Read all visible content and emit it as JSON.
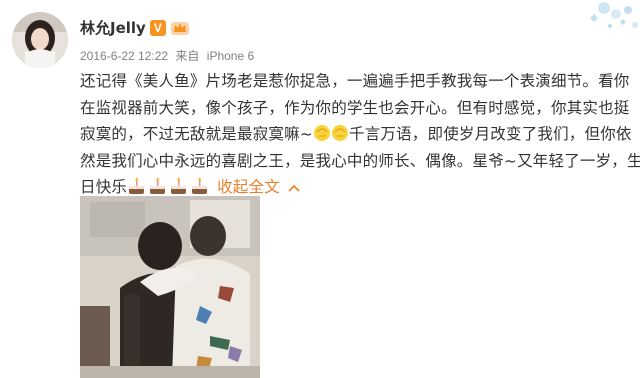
{
  "user": {
    "name": "林允Jelly",
    "verified_badge": "V",
    "verified_color": "#f7931e"
  },
  "post": {
    "timestamp": "2016-6-22 12:22",
    "source_prefix": "来自",
    "source": "iPhone 6",
    "lines": [
      "还记得《美人鱼》片场老是惹你捉急，一遍遍手把手教我每一个表演细节。看你",
      "在监视器前大笑，像个孩子，作为你的学生也会开心。但有时感觉，你其实也挺",
      "寂寞的，不过无敌就是最寂寞嘛~",
      "千言万语，即使岁月改变了我们，但你依",
      "然是我们心中永远的喜剧之王，是我心中的师长、偶像。星爷~又年轻了一岁，生",
      "日快乐"
    ],
    "collapse_label": "收起全文",
    "accent_color": "#ea7f26"
  },
  "icons": {
    "crown": "member-crown-icon",
    "wave": "wave-hands-emoji",
    "cake": "cake-emoji",
    "collapse": "chevron-up-icon"
  }
}
